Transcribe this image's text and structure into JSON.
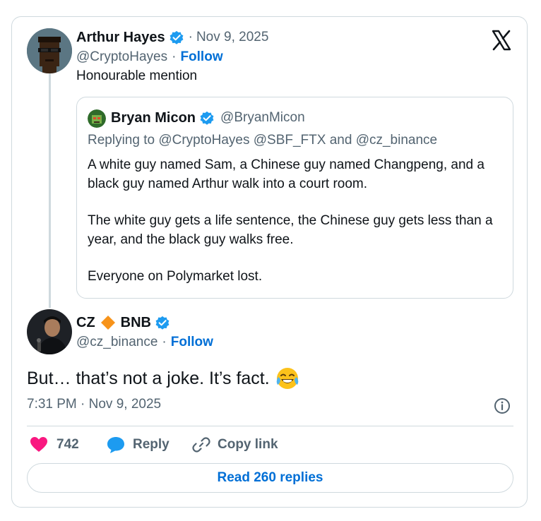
{
  "parent_tweet": {
    "author_name": "Arthur Hayes",
    "date": "Nov 9, 2025",
    "handle": "@CryptoHayes",
    "follow_label": "Follow",
    "text": "Honourable mention"
  },
  "quoted_tweet": {
    "author_name": "Bryan Micon",
    "handle": "@BryanMicon",
    "replying_prefix": "Replying to",
    "replying_to_1": "@CryptoHayes",
    "replying_to_2": "@SBF_FTX",
    "replying_and": "and",
    "replying_to_3": "@cz_binance",
    "paragraphs": [
      "A white guy named Sam, a Chinese guy named Changpeng, and a black guy named Arthur walk into a court room.",
      "The white guy gets a life sentence, the Chinese guy gets less than a year, and the black guy walks free.",
      "Everyone on Polymarket lost."
    ]
  },
  "main_tweet": {
    "author_name_part1": "CZ",
    "author_name_part2": "BNB",
    "handle": "@cz_binance",
    "follow_label": "Follow",
    "text": "But… that’s not a joke. It’s fact.",
    "emoji": "😂",
    "timestamp": "7:31 PM · Nov 9, 2025"
  },
  "actions": {
    "like_count": "742",
    "reply_label": "Reply",
    "copy_link_label": "Copy link"
  },
  "read_replies_label": "Read 260 replies",
  "colors": {
    "verified": "#1d9bf0",
    "link": "#006fd6",
    "like": "#f91880",
    "border": "#cfd9de",
    "secondary_text": "#536471"
  }
}
